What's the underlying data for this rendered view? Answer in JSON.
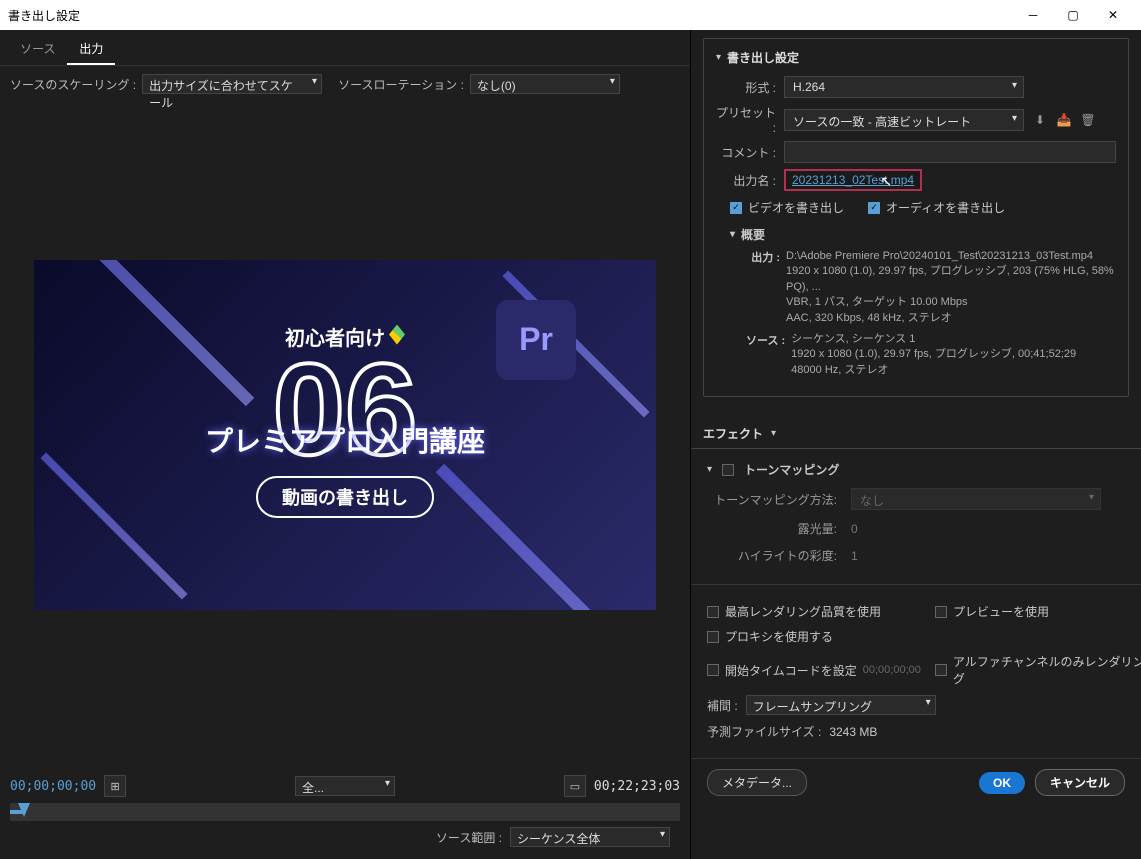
{
  "window": {
    "title": "書き出し設定"
  },
  "tabs": {
    "source": "ソース",
    "output": "出力"
  },
  "source_scaling": {
    "label": "ソースのスケーリング :",
    "value": "出力サイズに合わせてスケール"
  },
  "source_rotation": {
    "label": "ソースローテーション :",
    "value": "なし(0)"
  },
  "preview": {
    "beginner": "初心者向け",
    "pr": "Pr",
    "number": "06",
    "course_title": "プレミアプロ入門講座",
    "subtitle": "動画の書き出し"
  },
  "timeline": {
    "start_tc": "00;00;00;00",
    "end_tc": "00;22;23;03",
    "zoom_label": "全...",
    "range_label": "ソース範囲 :",
    "range_value": "シーケンス全体"
  },
  "export_settings": {
    "header": "書き出し設定",
    "format_label": "形式 :",
    "format_value": "H.264",
    "preset_label": "プリセット :",
    "preset_value": "ソースの一致 - 高速ビットレート",
    "comment_label": "コメント :",
    "comment_value": "",
    "output_name_label": "出力名 :",
    "output_name_value": "20231213_02Test.mp4",
    "export_video": "ビデオを書き出し",
    "export_audio": "オーディオを書き出し"
  },
  "summary": {
    "header": "概要",
    "output_label": "出力 :",
    "output_text": "D:\\Adobe Premiere Pro\\20240101_Test\\20231213_03Test.mp4\n1920 x 1080 (1.0), 29.97 fps, プログレッシブ, 203 (75% HLG, 58% PQ), ...\nVBR, 1 パス, ターゲット 10.00 Mbps\nAAC, 320 Kbps, 48 kHz, ステレオ",
    "source_label": "ソース :",
    "source_text": "シーケンス, シーケンス 1\n1920 x 1080 (1.0), 29.97 fps, プログレッシブ, 00;41;52;29\n48000 Hz, ステレオ"
  },
  "effects": {
    "header": "エフェクト"
  },
  "tone": {
    "header": "トーンマッピング",
    "method_label": "トーンマッピング方法:",
    "method_value": "なし",
    "exposure_label": "露光量:",
    "exposure_value": "0",
    "highlight_label": "ハイライトの彩度:",
    "highlight_value": "1"
  },
  "options": {
    "max_quality": "最高レンダリング品質を使用",
    "use_preview": "プレビューを使用",
    "use_proxy": "プロキシを使用する",
    "set_start_tc": "開始タイムコードを設定",
    "start_tc_value": "00;00;00;00",
    "alpha_only": "アルファチャンネルのみレンダリング",
    "interp_label": "補間 :",
    "interp_value": "フレームサンプリング",
    "filesize_label": "予測ファイルサイズ :",
    "filesize_value": "3243 MB"
  },
  "footer": {
    "metadata": "メタデータ...",
    "ok": "OK",
    "cancel": "キャンセル"
  }
}
